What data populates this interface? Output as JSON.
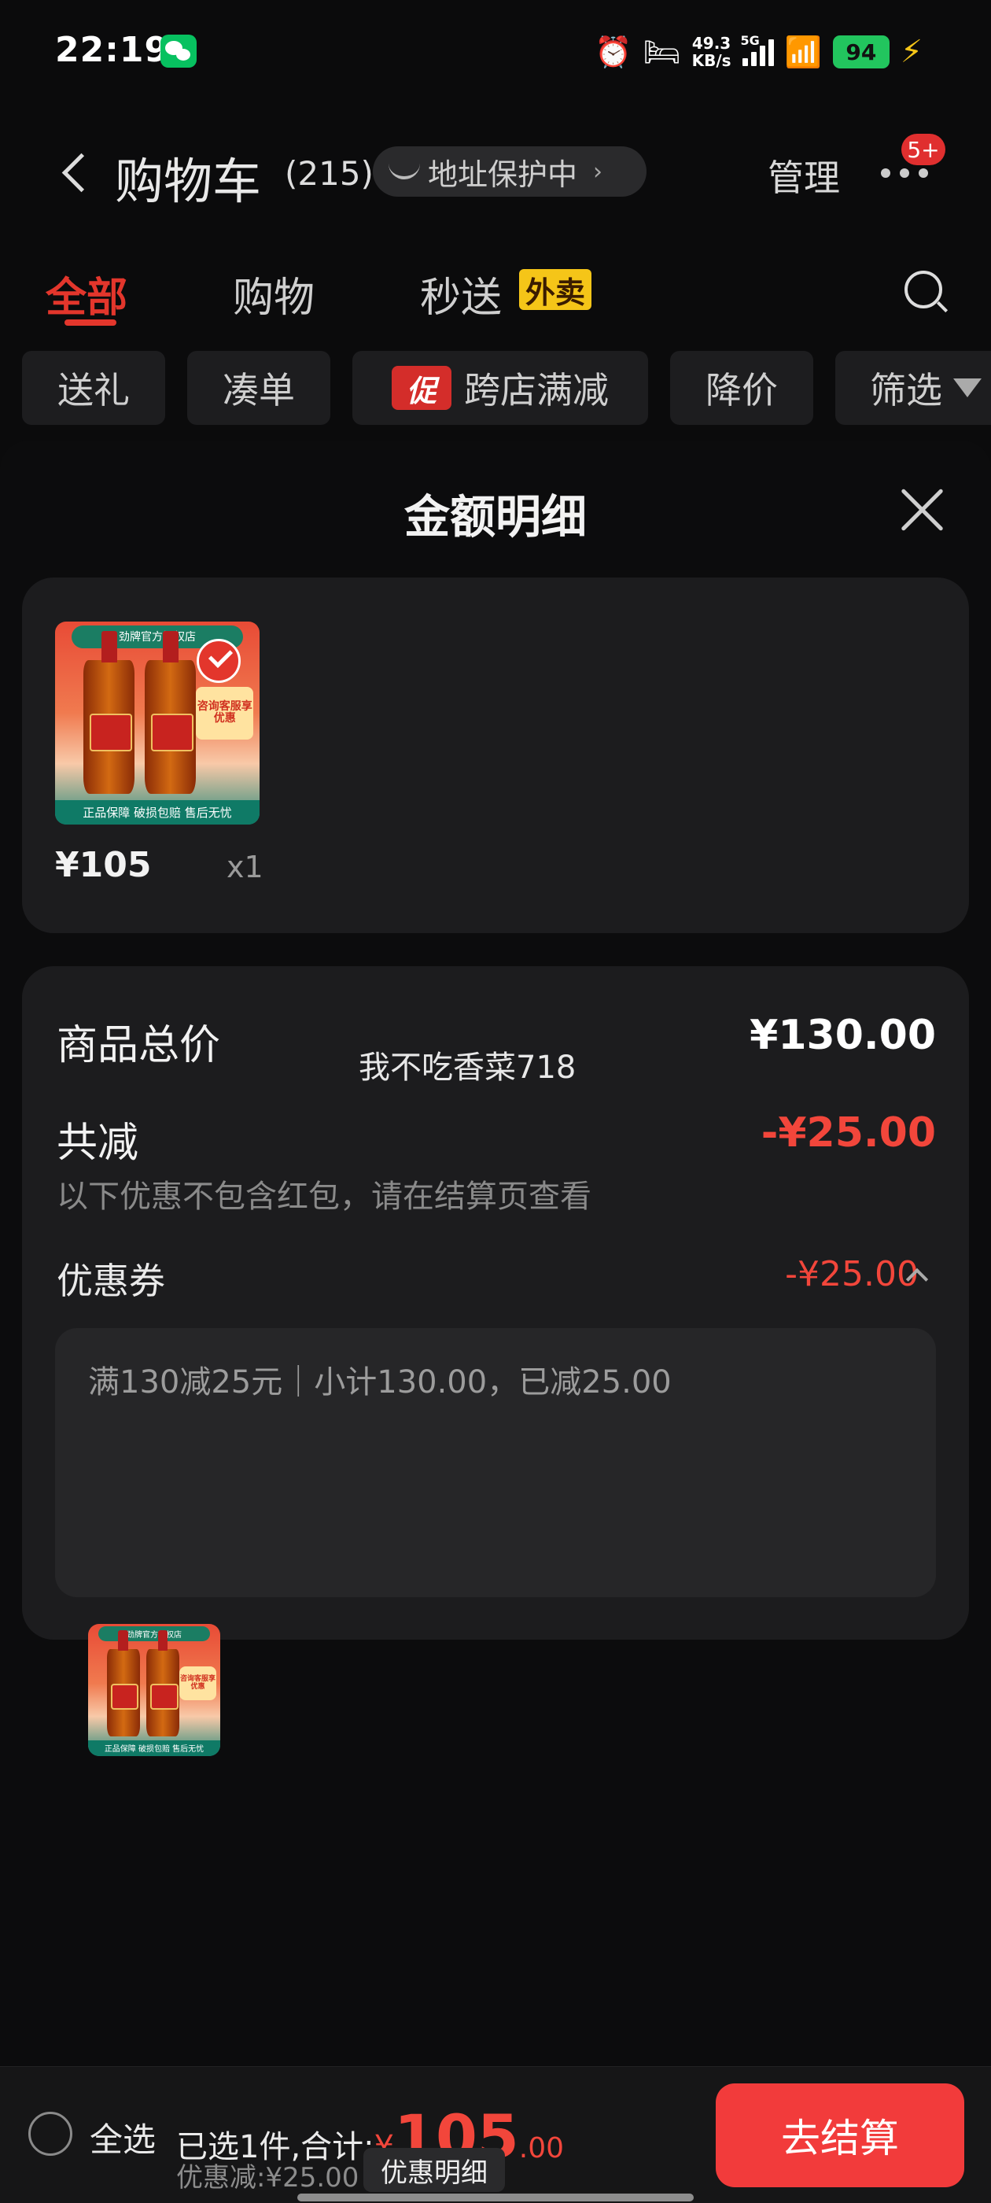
{
  "status_bar": {
    "time": "22:19",
    "net_speed_value": "49.3",
    "net_speed_unit": "KB/s",
    "network": "5G",
    "battery": "94",
    "icons": [
      "wechat-icon",
      "alarm-icon",
      "sleep-icon",
      "signal-icon",
      "wifi-icon",
      "battery-icon",
      "charging-icon"
    ]
  },
  "header": {
    "title": "购物车",
    "count": "(215)",
    "address_protection": "地址保护中",
    "manage": "管理",
    "badge": "5+"
  },
  "tabs": [
    {
      "label": "全部",
      "active": true
    },
    {
      "label": "购物",
      "active": false
    },
    {
      "label": "秒送",
      "active": false,
      "tag": "外卖"
    }
  ],
  "filters": {
    "gift": "送礼",
    "combine": "凑单",
    "promo_tag": "促",
    "promo": "跨店满减",
    "price_drop": "降价",
    "filter": "筛选"
  },
  "sheet": {
    "title": "金额明细",
    "item": {
      "store_banner": "劲牌官方授权店",
      "promo_seal": "咨询客服享优惠",
      "guarantee": "正品保障 破损包赔 售后无忧",
      "price": "¥105",
      "qty": "x1"
    },
    "summary": {
      "total_label": "商品总价",
      "total_value": "¥130.00",
      "watermark": "我不吃香菜718",
      "reduce_label": "共减",
      "reduce_value": "-¥25.00",
      "reduce_note": "以下优惠不包含红包，请在结算页查看",
      "coupon_label": "优惠券",
      "coupon_value": "-¥25.00",
      "coupon_detail": "满130减25元｜小计130.00，已减25.00"
    }
  },
  "bottom_bar": {
    "select_all": "全选",
    "selected_prefix": "已选1件,合计:",
    "currency": "¥",
    "amount_int": "105",
    "amount_dec": ".00",
    "discount_note": "优惠减:¥25.00",
    "detail_button": "优惠明细",
    "checkout": "去结算"
  },
  "colors": {
    "accent_red": "#e3362c",
    "price_red": "#f2463b",
    "checkout_red": "#f23b3b",
    "tag_yellow": "#f5c518",
    "background": "#0b0b0c",
    "card": "#1c1c1e"
  }
}
